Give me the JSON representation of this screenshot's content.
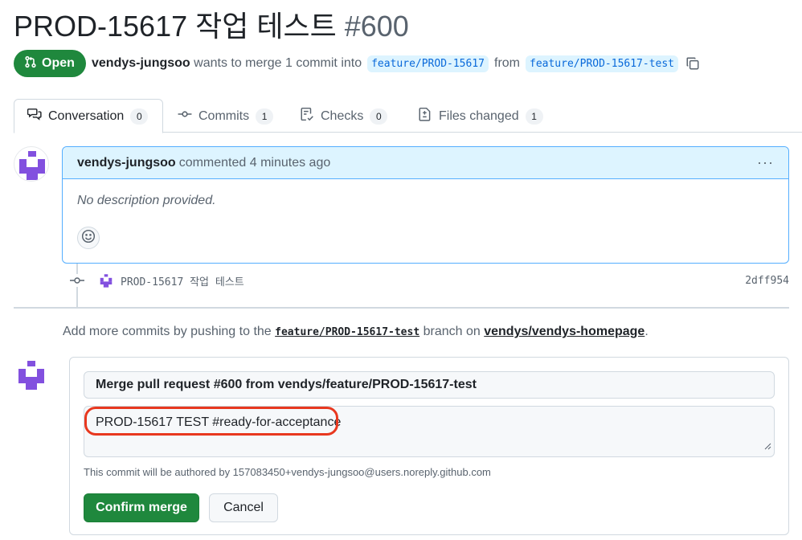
{
  "pr": {
    "title": "PROD-15617 작업 테스트",
    "number": "#600",
    "state": "Open",
    "author": "vendys-jungsoo",
    "merge_text": "wants to merge 1 commit into",
    "base_branch": "feature/PROD-15617",
    "from_text": "from",
    "head_branch": "feature/PROD-15617-test"
  },
  "tabs": [
    {
      "label": "Conversation",
      "count": "0",
      "icon": "comment-discussion-icon"
    },
    {
      "label": "Commits",
      "count": "1",
      "icon": "git-commit-icon"
    },
    {
      "label": "Checks",
      "count": "0",
      "icon": "checklist-icon"
    },
    {
      "label": "Files changed",
      "count": "1",
      "icon": "file-diff-icon"
    }
  ],
  "comment": {
    "author": "vendys-jungsoo",
    "action": "commented 4 minutes ago",
    "body": "No description provided."
  },
  "commit": {
    "message": "PROD-15617 작업 테스트",
    "sha": "2dff954"
  },
  "push_note": {
    "prefix": "Add more commits by pushing to the",
    "branch": "feature/PROD-15617-test",
    "middle": "branch on",
    "repo": "vendys/vendys-homepage",
    "suffix": "."
  },
  "merge": {
    "title_value": "Merge pull request #600 from vendys/feature/PROD-15617-test",
    "message_value": "PROD-15617 TEST #ready-for-acceptance",
    "author_note": "This commit will be authored by 157083450+vendys-jungsoo@users.noreply.github.com",
    "confirm_label": "Confirm merge",
    "cancel_label": "Cancel"
  },
  "colors": {
    "open_green": "#1f883d",
    "link_blue": "#0969da",
    "highlight_red": "#e8381f",
    "avatar_purple": "#8250df"
  }
}
